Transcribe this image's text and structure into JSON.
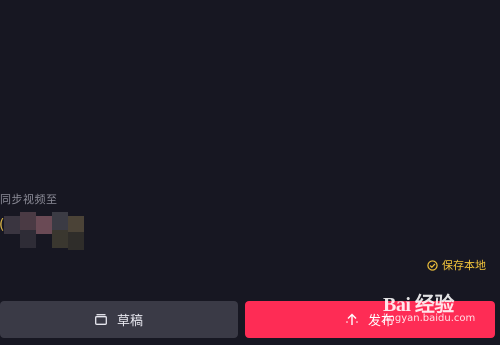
{
  "sync": {
    "label": "同步视频至",
    "paren": "("
  },
  "save_local": {
    "icon": "check-circle-icon",
    "label": "保存本地",
    "color": "#f3c43b"
  },
  "actions": {
    "draft": {
      "icon": "draft-box-icon",
      "label": "草稿",
      "bg": "#3a3a46"
    },
    "publish": {
      "icon": "upload-arrow-icon",
      "label": "发布",
      "bg": "#fe2c55"
    }
  },
  "watermark": {
    "text": "Bai 经验",
    "url": "jingyan.baidu.com"
  }
}
